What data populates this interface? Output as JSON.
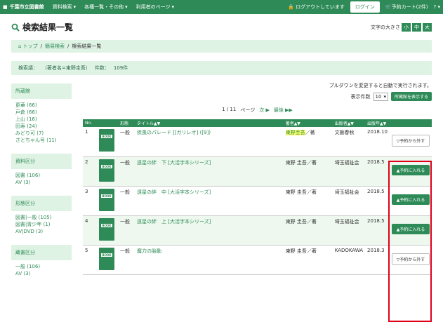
{
  "topbar": {
    "logo": "千葉市立図書館",
    "nav": [
      "資料検索",
      "各種一覧・その他",
      "利用者のページ"
    ],
    "logout_text": "ログアウトしています",
    "login_label": "ログイン",
    "cart_label": "予約カート(2件)",
    "help_label": "?"
  },
  "header": {
    "title": "検索結果一覧",
    "font_size_label": "文字の大きさ",
    "font_sizes": [
      "小",
      "中",
      "大"
    ]
  },
  "breadcrumb": [
    "トップ",
    "簡易検索",
    "検索結果一覧"
  ],
  "criteria": {
    "label": "検索語：",
    "value": "（著者名=東野圭吾）",
    "count_label": "件数：",
    "count": "109件"
  },
  "sidebar": [
    {
      "heading": "所蔵館",
      "items": [
        "更華 (66)",
        "戸倉 (66)",
        "上山 (16)",
        "田寿 (24)",
        "みどり可 (7)",
        "さとちゃん号 (11)"
      ]
    },
    {
      "heading": "資料区分",
      "items": [
        "図書 (106)",
        "AV (3)"
      ]
    },
    {
      "heading": "形態区分",
      "items": [
        "図書|一般 (105)",
        "図書|青少年 (1)",
        "AV|DVD (3)"
      ]
    },
    {
      "heading": "蔵書区分",
      "items": [
        "一般 (106)",
        "AV (3)"
      ]
    }
  ],
  "controls": {
    "note": "プルダウンを変更すると自動で実行されます。",
    "display_count_label": "表示件数",
    "display_count_value": "10",
    "show_location_label": "所蔵館を表示する"
  },
  "pager": {
    "current": "1 / 11",
    "unit": "ページ",
    "next": "次 ▶",
    "last": "最後 ▶▶"
  },
  "table": {
    "headers": [
      "No.",
      "形態",
      "タイトル▲▼",
      "著者▲▼",
      "出版者▲▼",
      "出版年▲▼",
      ""
    ],
    "rows": [
      {
        "no": "1",
        "type": "一般",
        "title": "疾風のパレード [[ガリレオ] ([9])",
        "author_hl": "東野圭吾",
        "author_rest": "／著",
        "publisher": "文藝春秋",
        "year": "2018.10",
        "action": "▽予約から外す"
      },
      {
        "no": "2",
        "type": "一般",
        "title": "遠星の絆　下 [大活字本シリーズ]",
        "author_hl": "",
        "author_rest": "東野 圭吾／著",
        "publisher": "埼玉福祉会",
        "year": "2018.5",
        "action": "▲予約に入れる"
      },
      {
        "no": "3",
        "type": "一般",
        "title": "遠星の絆　中 [大活字本シリーズ]",
        "author_hl": "",
        "author_rest": "東野 圭吾／著",
        "publisher": "埼玉福祉会",
        "year": "2018.5",
        "action": "▲予約に入れる"
      },
      {
        "no": "4",
        "type": "一般",
        "title": "遠星の絆　上 [大活字本シリーズ]",
        "author_hl": "",
        "author_rest": "東野 圭吾／著",
        "publisher": "埼玉福祉会",
        "year": "2018.5",
        "action": "▲予約に入れる"
      },
      {
        "no": "5",
        "type": "一般",
        "title": "魔力の胎動",
        "author_hl": "",
        "author_rest": "東野 圭吾／著",
        "publisher": "KADOKAWA",
        "year": "2018.3",
        "action": "▽予約から外す"
      }
    ],
    "book_label": "BOOK"
  }
}
